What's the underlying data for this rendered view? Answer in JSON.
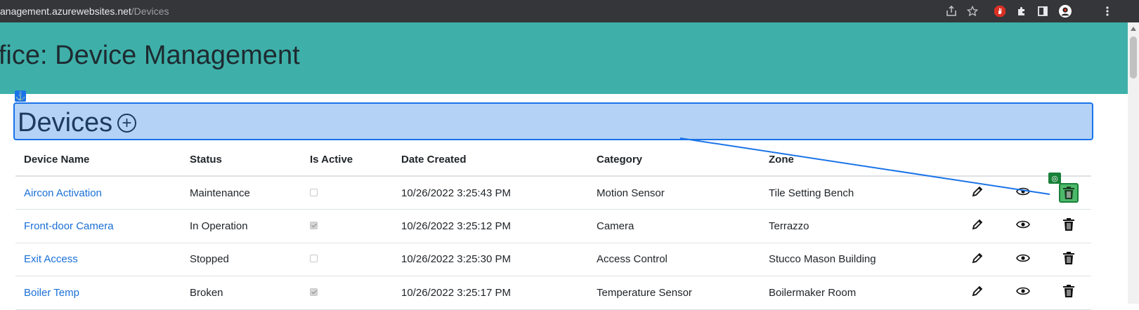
{
  "browser": {
    "url_host": "anagement.azurewebsites.net",
    "url_path": "/Devices"
  },
  "header": {
    "title": "ffice: Device Management"
  },
  "section": {
    "title": "Devices"
  },
  "table": {
    "columns": [
      "Device Name",
      "Status",
      "Is Active",
      "Date Created",
      "Category",
      "Zone"
    ],
    "rows": [
      {
        "name": "Aircon Activation",
        "status": "Maintenance",
        "active": false,
        "date": "10/26/2022 3:25:43 PM",
        "category": "Motion Sensor",
        "zone": "Tile Setting Bench"
      },
      {
        "name": "Front-door Camera",
        "status": "In Operation",
        "active": true,
        "date": "10/26/2022 3:25:12 PM",
        "category": "Camera",
        "zone": "Terrazzo"
      },
      {
        "name": "Exit Access",
        "status": "Stopped",
        "active": false,
        "date": "10/26/2022 3:25:30 PM",
        "category": "Access Control",
        "zone": "Stucco Mason Building"
      },
      {
        "name": "Boiler Temp",
        "status": "Broken",
        "active": true,
        "date": "10/26/2022 3:25:17 PM",
        "category": "Temperature Sensor",
        "zone": "Boilermaker Room"
      }
    ]
  },
  "colors": {
    "header_bg": "#3eb0a9",
    "highlight_bg": "#b4d2f5",
    "highlight_border": "#1a73e8",
    "link": "#1a6fd6",
    "selected": "#188038"
  }
}
